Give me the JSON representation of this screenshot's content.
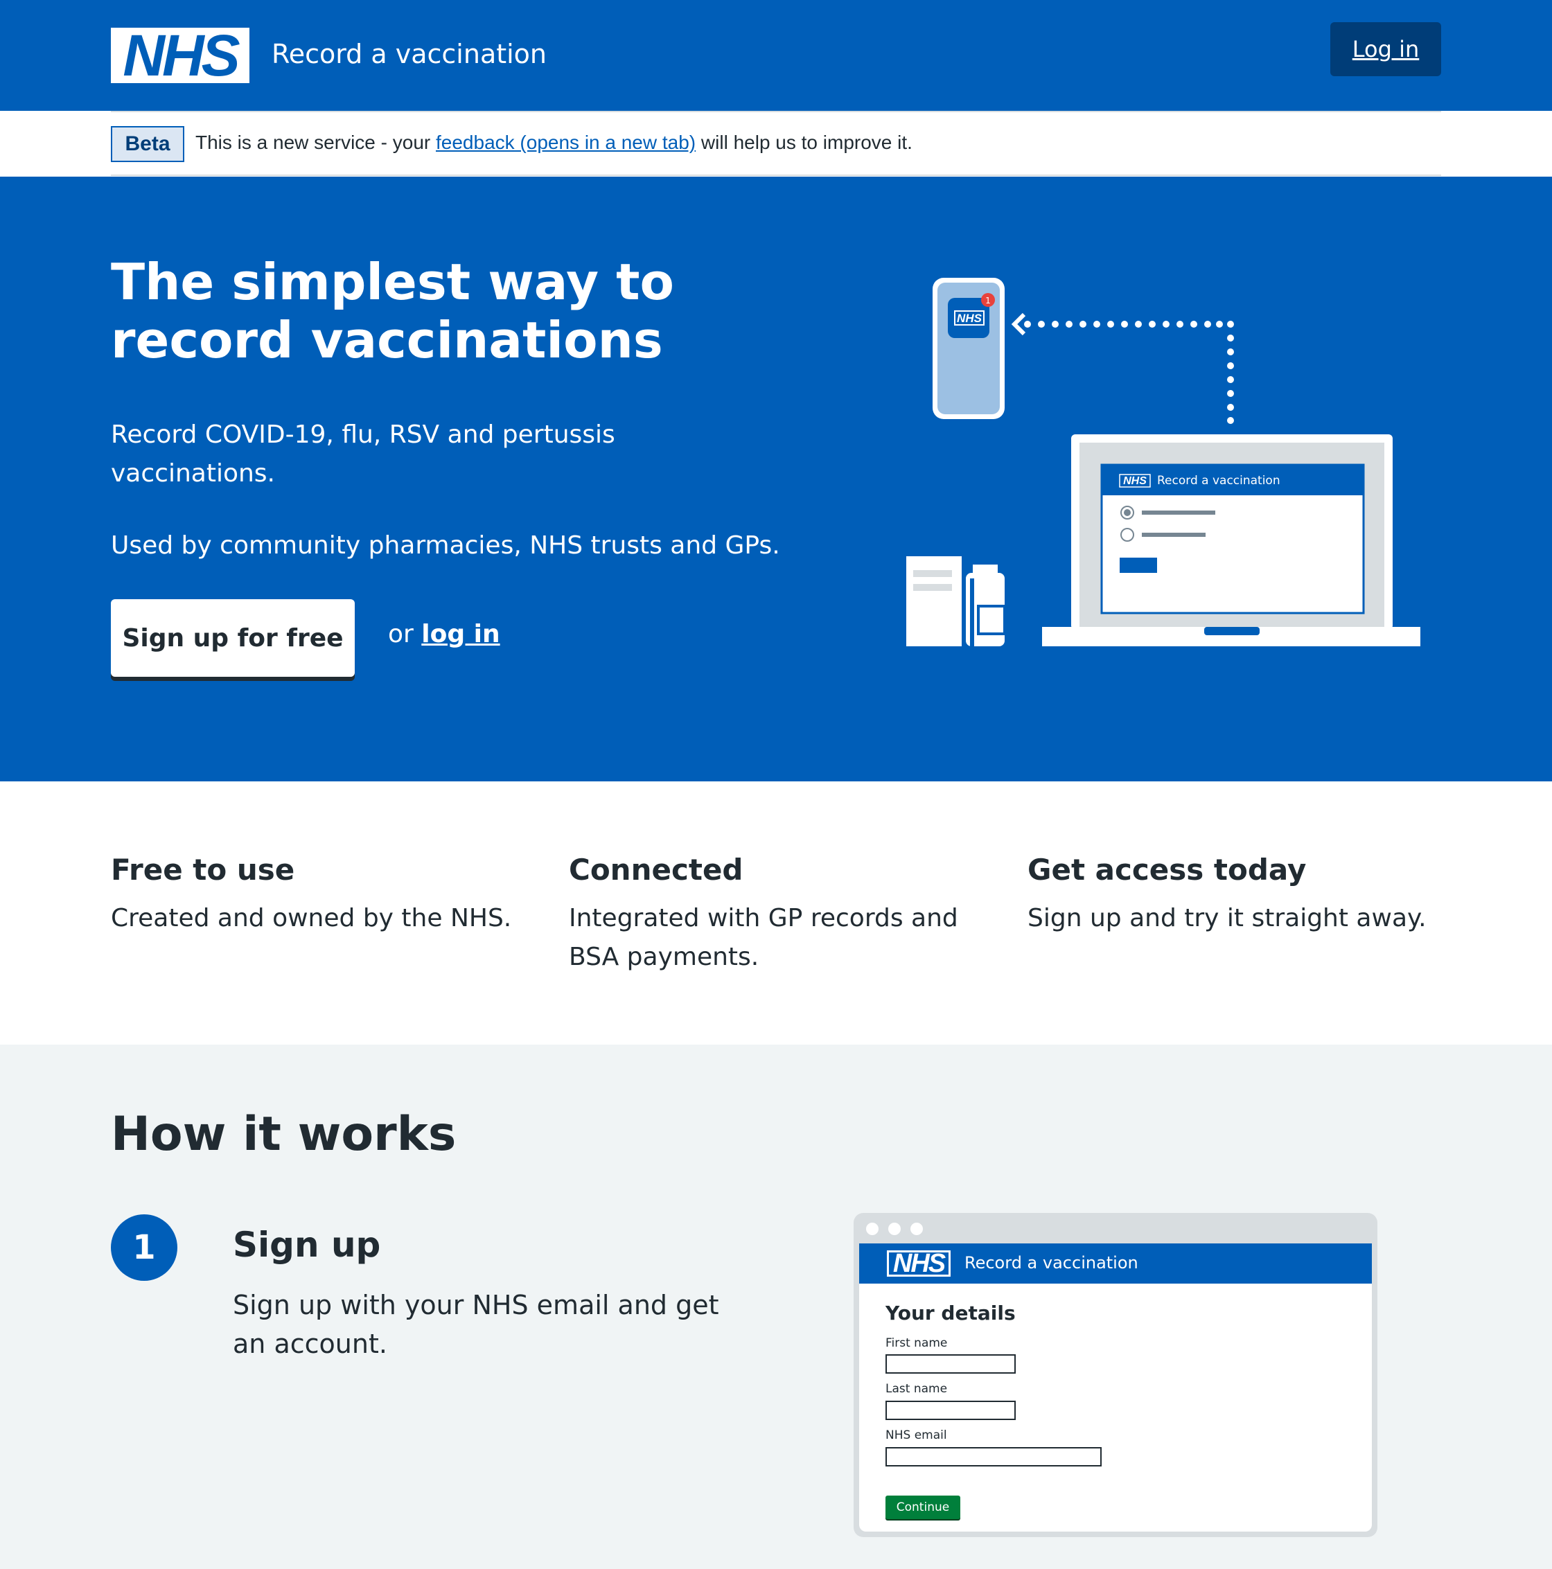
{
  "header": {
    "logo_text": "NHS",
    "service_name": "Record a vaccination",
    "login_label": "Log in"
  },
  "beta": {
    "tag": "Beta",
    "text_before": "This is a new service - your ",
    "link_text": "feedback (opens in a new tab)",
    "text_after": " will help us to improve it."
  },
  "hero": {
    "title": "The simplest way to record vaccinations",
    "subtitle": "Record COVID-19, flu, RSV and pertussis vaccinations.",
    "used_by": "Used by community pharmacies, NHS trusts and GPs.",
    "signup_label": "Sign up for free",
    "or_text": "or ",
    "login_link": "log in",
    "illustration": {
      "phone_logo": "NHS",
      "notification_count": "1",
      "laptop_logo": "NHS",
      "laptop_service_name": "Record a vaccination"
    }
  },
  "features": [
    {
      "title": "Free to use",
      "text": "Created and owned by the NHS."
    },
    {
      "title": "Connected",
      "text": "Integrated with GP records and BSA payments."
    },
    {
      "title": "Get access today",
      "text": "Sign up and try it straight away."
    }
  ],
  "how": {
    "title": "How it works",
    "steps": [
      {
        "number": "1",
        "title": "Sign up",
        "text": "Sign up with your NHS email and get an account."
      }
    ],
    "mock": {
      "logo_text": "NHS",
      "service_name": "Record a vaccination",
      "heading": "Your details",
      "fields": [
        "First name",
        "Last name",
        "NHS email"
      ],
      "continue_label": "Continue"
    }
  },
  "colors": {
    "nhs_blue": "#005eb8",
    "nhs_dark_blue": "#003d78",
    "text": "#212b32",
    "grey_bg": "#f0f4f5",
    "green": "#007f3b"
  }
}
